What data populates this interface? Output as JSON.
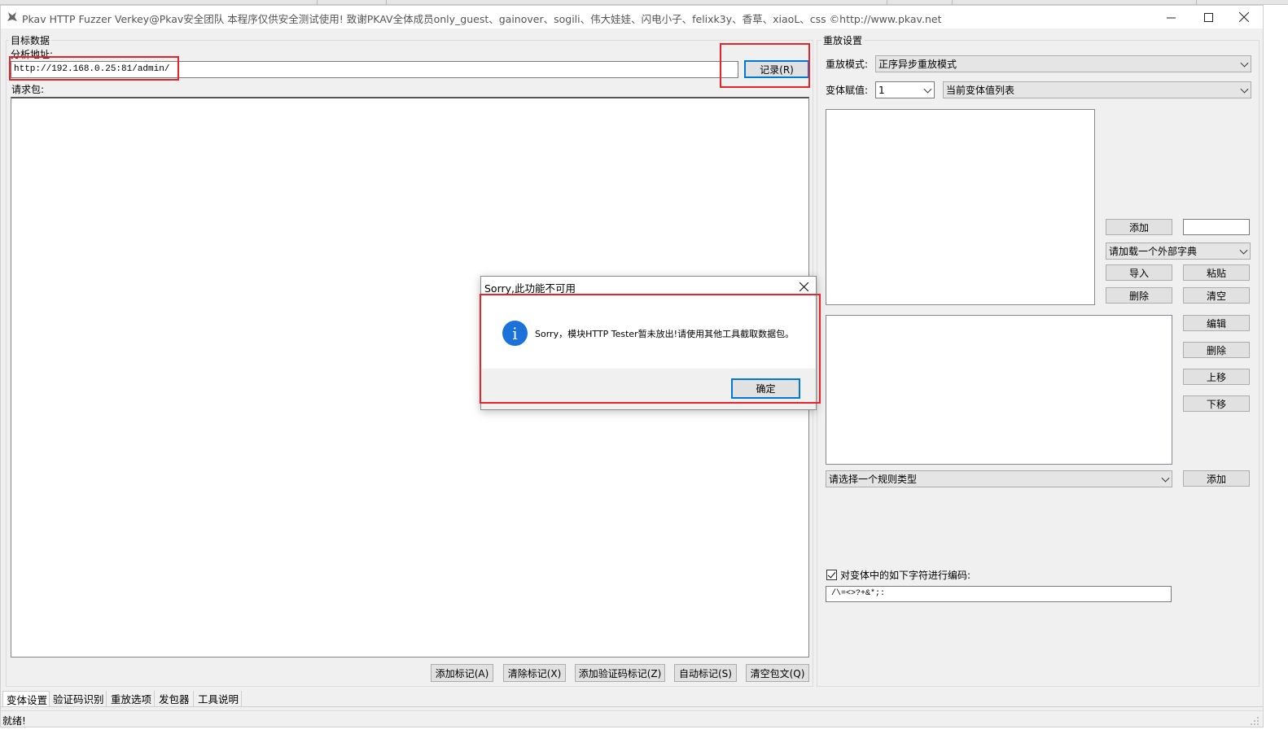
{
  "window": {
    "title": "Pkav HTTP Fuzzer  Verkey@Pkav安全团队  本程序仅供安全测试使用!  致谢PKAV全体成员only_guest、gainover、sogili、伟大娃娃、闪电小子、felixk3y、香草、xiaoL、css  ©http://www.pkav.net"
  },
  "target": {
    "group_title": "目标数据",
    "url_label": "分析地址:",
    "url_value": "http://192.168.0.25:81/admin/",
    "record_button": "记录(R)",
    "request_label": "请求包:"
  },
  "bottom_buttons": {
    "add_mark": "添加标记(A)",
    "clear_mark": "清除标记(X)",
    "add_captcha_mark": "添加验证码标记(Z)",
    "auto_mark": "自动标记(S)",
    "clear_body": "清空包文(Q)"
  },
  "replay": {
    "group_title": "重放设置",
    "mode_label": "重放模式:",
    "mode_value": "正序异步重放模式",
    "var_label": "变体赋值:",
    "var_value": "1",
    "var_list_value": "当前变体值列表",
    "add_button": "添加",
    "dict_value": "请加载一个外部字典",
    "import_button": "导入",
    "paste_button": "粘贴",
    "delete_button": "删除",
    "clear_button": "清空",
    "edit_button": "编辑",
    "rule_delete_button": "删除",
    "up_button": "上移",
    "down_button": "下移",
    "rule_type_value": "请选择一个规则类型",
    "rule_add_button": "添加",
    "encode_label": "对变体中的如下字符进行编码:",
    "encode_chars": "/\\=<>?+&*;:"
  },
  "tabs": [
    "变体设置",
    "验证码识别",
    "重放选项",
    "发包器",
    "工具说明"
  ],
  "status": "就绪!",
  "dialog": {
    "title": "Sorry,此功能不可用",
    "message": "Sorry，模块HTTP Tester暂未放出!请使用其他工具截取数据包。",
    "ok_button": "确定",
    "icon_glyph": "i"
  },
  "colors": {
    "highlight_red": "#e8232b",
    "info_blue": "#1c72d8",
    "default_button_blue": "#0078d7"
  }
}
